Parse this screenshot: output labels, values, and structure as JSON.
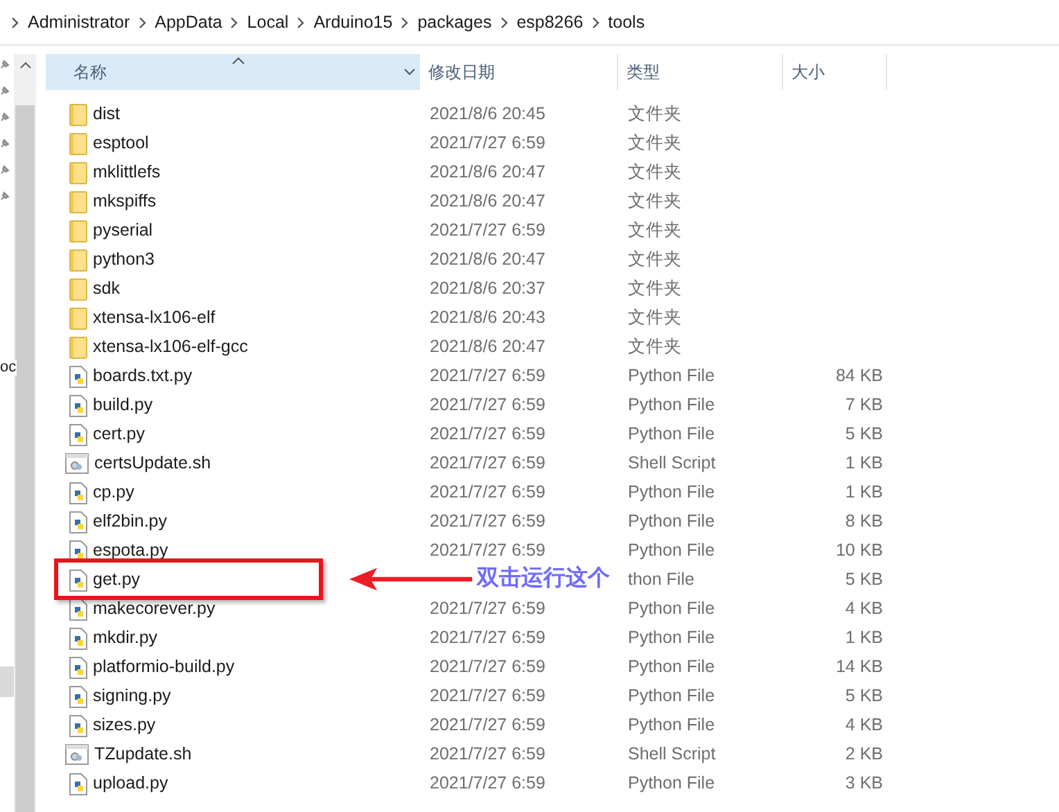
{
  "breadcrumb": [
    "Administrator",
    "AppData",
    "Local",
    "Arduino15",
    "packages",
    "esp8266",
    "tools"
  ],
  "nav_pane": {
    "partial_label": "oc"
  },
  "columns": [
    {
      "label": "名称",
      "sorted": true
    },
    {
      "label": "修改日期",
      "sorted": false
    },
    {
      "label": "类型",
      "sorted": false
    },
    {
      "label": "大小",
      "sorted": false
    }
  ],
  "files": [
    {
      "kind": "folder",
      "name": "dist",
      "date": "2021/8/6 20:45",
      "type": "文件夹"
    },
    {
      "kind": "folder",
      "name": "esptool",
      "date": "2021/7/27 6:59",
      "type": "文件夹"
    },
    {
      "kind": "folder",
      "name": "mklittlefs",
      "date": "2021/8/6 20:47",
      "type": "文件夹"
    },
    {
      "kind": "folder",
      "name": "mkspiffs",
      "date": "2021/8/6 20:47",
      "type": "文件夹"
    },
    {
      "kind": "folder",
      "name": "pyserial",
      "date": "2021/7/27 6:59",
      "type": "文件夹"
    },
    {
      "kind": "folder",
      "name": "python3",
      "date": "2021/8/6 20:47",
      "type": "文件夹"
    },
    {
      "kind": "folder",
      "name": "sdk",
      "date": "2021/8/6 20:37",
      "type": "文件夹"
    },
    {
      "kind": "folder",
      "name": "xtensa-lx106-elf",
      "date": "2021/8/6 20:43",
      "type": "文件夹"
    },
    {
      "kind": "folder",
      "name": "xtensa-lx106-elf-gcc",
      "date": "2021/8/6 20:47",
      "type": "文件夹"
    },
    {
      "kind": "python",
      "name": "boards.txt.py",
      "date": "2021/7/27 6:59",
      "type": "Python File",
      "size": "84 KB"
    },
    {
      "kind": "python",
      "name": "build.py",
      "date": "2021/7/27 6:59",
      "type": "Python File",
      "size": "7 KB"
    },
    {
      "kind": "python",
      "name": "cert.py",
      "date": "2021/7/27 6:59",
      "type": "Python File",
      "size": "5 KB"
    },
    {
      "kind": "shell",
      "name": "certsUpdate.sh",
      "date": "2021/7/27 6:59",
      "type": "Shell Script",
      "size": "1 KB"
    },
    {
      "kind": "python",
      "name": "cp.py",
      "date": "2021/7/27 6:59",
      "type": "Python File",
      "size": "1 KB"
    },
    {
      "kind": "python",
      "name": "elf2bin.py",
      "date": "2021/7/27 6:59",
      "type": "Python File",
      "size": "8 KB"
    },
    {
      "kind": "python",
      "name": "espota.py",
      "date": "2021/7/27 6:59",
      "type": "Python File",
      "size": "10 KB"
    },
    {
      "kind": "python",
      "name": "get.py",
      "type": "thon File",
      "size": "5 KB",
      "highlighted": true
    },
    {
      "kind": "python",
      "name": "makecorever.py",
      "date": "2021/7/27 6:59",
      "type": "Python File",
      "size": "4 KB"
    },
    {
      "kind": "python",
      "name": "mkdir.py",
      "date": "2021/7/27 6:59",
      "type": "Python File",
      "size": "1 KB"
    },
    {
      "kind": "python",
      "name": "platformio-build.py",
      "date": "2021/7/27 6:59",
      "type": "Python File",
      "size": "14 KB"
    },
    {
      "kind": "python",
      "name": "signing.py",
      "date": "2021/7/27 6:59",
      "type": "Python File",
      "size": "5 KB"
    },
    {
      "kind": "python",
      "name": "sizes.py",
      "date": "2021/7/27 6:59",
      "type": "Python File",
      "size": "4 KB"
    },
    {
      "kind": "shell",
      "name": "TZupdate.sh",
      "date": "2021/7/27 6:59",
      "type": "Shell Script",
      "size": "2 KB"
    },
    {
      "kind": "python",
      "name": "upload.py",
      "date": "2021/7/27 6:59",
      "type": "Python File",
      "size": "3 KB"
    }
  ],
  "annotation": {
    "text": "双击运行这个"
  }
}
